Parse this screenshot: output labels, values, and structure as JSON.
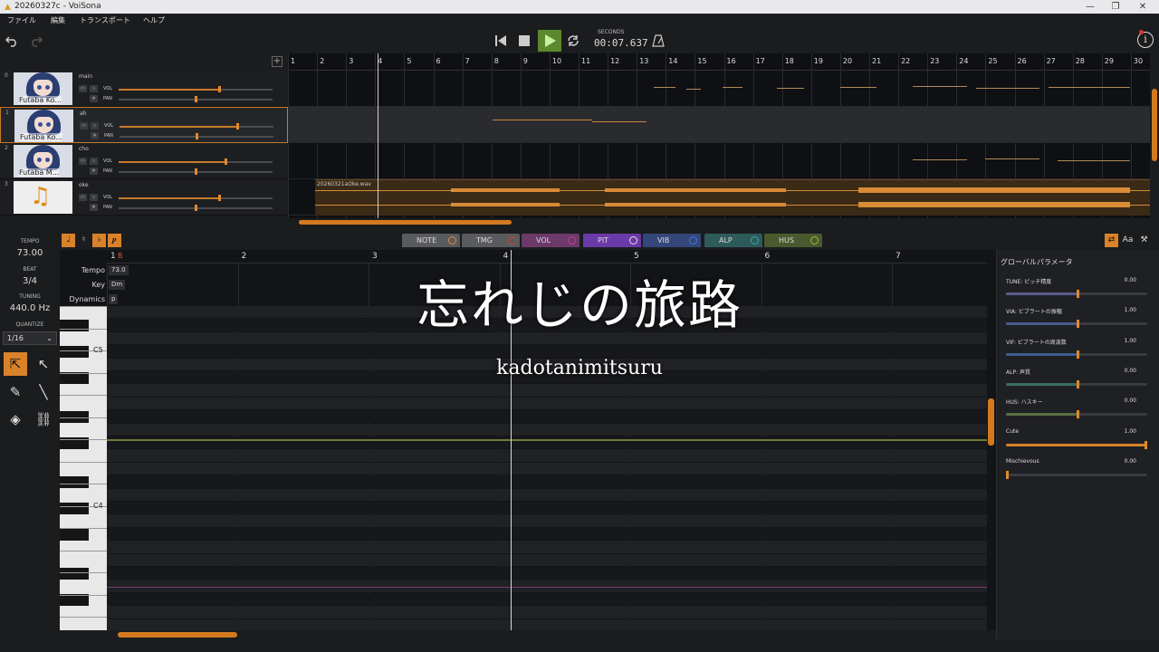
{
  "window": {
    "title": "20260327c - VoiSona",
    "min": "—",
    "max": "❐",
    "close": "✕"
  },
  "menu": [
    "ファイル",
    "編集",
    "トランスポート",
    "ヘルプ"
  ],
  "transport": {
    "seconds_label": "SECONDS",
    "time": "00:07.637",
    "undo_icon": "undo-icon",
    "redo_icon": "redo-icon",
    "metronome_icon": "metronome-icon",
    "info_icon": "info-icon",
    "play_color": "#5b8a2e",
    "accent": "#d8822a"
  },
  "tracks": [
    {
      "no": "0",
      "name": "main",
      "thumb": "Futaba Ko...",
      "vol_label": "VOL",
      "pan_label": "PAN",
      "vol": 0.65,
      "pan": 0.5
    },
    {
      "no": "1",
      "name": "ah",
      "thumb": "Futaba Ko...",
      "vol_label": "VOL",
      "pan_label": "PAN",
      "vol": 0.76,
      "pan": 0.5
    },
    {
      "no": "2",
      "name": "cho",
      "thumb": "Futaba M...",
      "vol_label": "VOL",
      "pan_label": "PAN",
      "vol": 0.69,
      "pan": 0.5
    },
    {
      "no": "3",
      "name": "oke",
      "thumb": "",
      "vol_label": "VOL",
      "pan_label": "PAN",
      "vol": 0.65,
      "pan": 0.5
    }
  ],
  "mute_label": "m",
  "solo_label": "s",
  "arrange": {
    "bars": [
      "1",
      "2",
      "3",
      "4",
      "5",
      "6",
      "7",
      "8",
      "9",
      "10",
      "11",
      "12",
      "13",
      "14",
      "15",
      "16",
      "17",
      "18",
      "19",
      "20",
      "21",
      "22",
      "23",
      "24",
      "25",
      "26",
      "27",
      "28",
      "29",
      "30"
    ],
    "clip_name": "20260321aOke.wav"
  },
  "left": {
    "tempo_label": "TEMPO",
    "tempo": "73.00",
    "beat_label": "BEAT",
    "beat": "3/4",
    "tuning_label": "TUNING",
    "tuning": "440.0 Hz",
    "quantize_label": "QUANTIZE",
    "quantize": "1/16"
  },
  "editor_tabs": [
    {
      "label": "NOTE",
      "color": "#5a5b5f",
      "eye": "#e08a2e"
    },
    {
      "label": "TMG",
      "color": "#5a5b5f",
      "eye": "#d0402e"
    },
    {
      "label": "VOL",
      "color": "#6b3a6a",
      "eye": "#c040a0"
    },
    {
      "label": "PIT",
      "color": "#6a3aa8",
      "eye": "#dddddd"
    },
    {
      "label": "VIB",
      "color": "#35477a",
      "eye": "#3f7ad8"
    },
    {
      "label": "ALP",
      "color": "#2e5a5a",
      "eye": "#30b0a0"
    },
    {
      "label": "HUS",
      "color": "#4a5a2e",
      "eye": "#90c030"
    }
  ],
  "editor": {
    "bars": [
      "1",
      "2",
      "3",
      "4",
      "5",
      "6",
      "7"
    ],
    "bar1_marker": "B",
    "conditions": [
      {
        "label": "Tempo",
        "value": "73.0"
      },
      {
        "label": "Key",
        "value": "Dm"
      },
      {
        "label": "Dynamics",
        "value": "p"
      }
    ],
    "key_labels": {
      "c5": "C5",
      "c4": "C4"
    }
  },
  "overlay": {
    "title": "忘れじの旅路",
    "artist": "kadotanimitsuru"
  },
  "global_params": {
    "title": "グローバルパラメータ",
    "params": [
      {
        "label": "TUNE: ピッチ精度",
        "value": "0.00",
        "level": 0.5,
        "color": "#5a5a90"
      },
      {
        "label": "VIA: ビブラートの振幅",
        "value": "1.00",
        "level": 0.5,
        "color": "#4a5a90"
      },
      {
        "label": "VIF: ビブラートの周波数",
        "value": "1.00",
        "level": 0.5,
        "color": "#3a6090"
      },
      {
        "label": "ALP: 声質",
        "value": "0.00",
        "level": 0.5,
        "color": "#3a7060"
      },
      {
        "label": "HUS: ハスキー",
        "value": "0.00",
        "level": 0.5,
        "color": "#5a7040"
      },
      {
        "label": "Cute",
        "value": "1.00",
        "level": 1.0,
        "color": "#d8822a"
      },
      {
        "label": "Mischievous",
        "value": "0.00",
        "level": 0.0,
        "color": "#3a3b40"
      }
    ]
  }
}
